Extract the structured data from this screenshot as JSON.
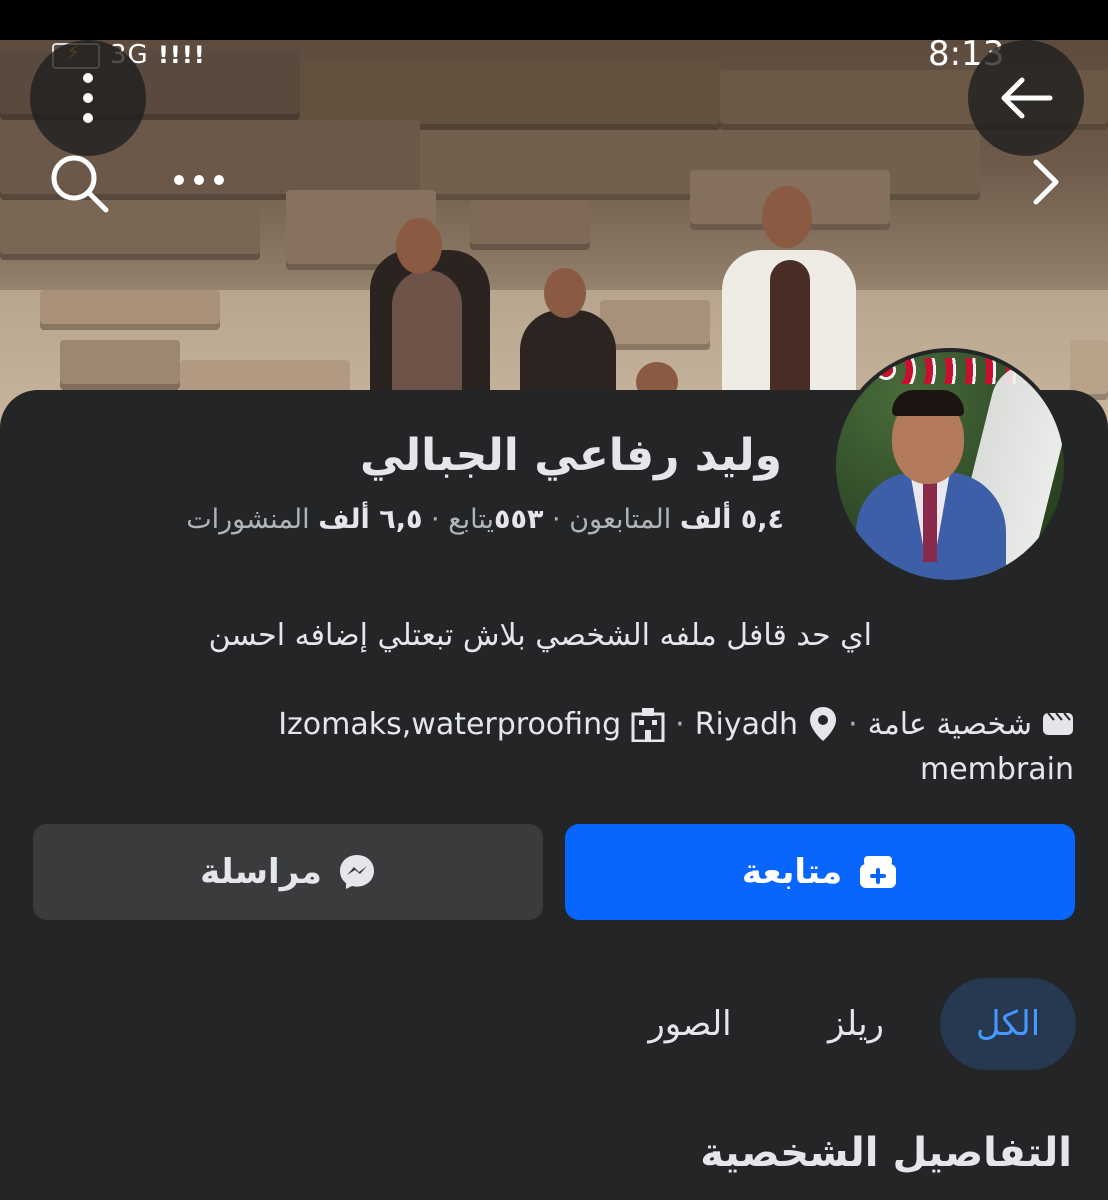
{
  "status_bar": {
    "network": "3G",
    "signal": "!!!!",
    "time": "8:13"
  },
  "profile": {
    "name": "وليد رفاعي الجبالي",
    "followers_value": "٥,٤ ألف",
    "followers_label": "المتابعون",
    "following_value": "٥٥٣",
    "following_label": "يتابع",
    "posts_value": "٦,٥ ألف",
    "posts_label": "المنشورات",
    "bio": "اي حد قافل ملفه الشخصي  بلاش تبعتلي إضافه  احسن",
    "category": "شخصية عامة",
    "location": "Riyadh",
    "workplace": "Izomaks,waterproofing",
    "workplace_cont": "membrain"
  },
  "actions": {
    "follow_label": "متابعة",
    "message_label": "مراسلة"
  },
  "tabs": [
    {
      "label": "الكل",
      "active": true
    },
    {
      "label": "ريلز",
      "active": false
    },
    {
      "label": "الصور",
      "active": false
    }
  ],
  "section": {
    "title": "التفاصيل الشخصية"
  },
  "colors": {
    "accent": "#0866ff",
    "background": "#242526",
    "active_tab_bg": "#263951",
    "active_tab_text": "#4599ff"
  },
  "icons": [
    "back-arrow-icon",
    "more-vertical-icon",
    "search-icon",
    "more-horizontal-icon",
    "chevron-right-icon",
    "video-icon",
    "location-pin-icon",
    "building-icon",
    "follow-icon",
    "messenger-icon"
  ]
}
